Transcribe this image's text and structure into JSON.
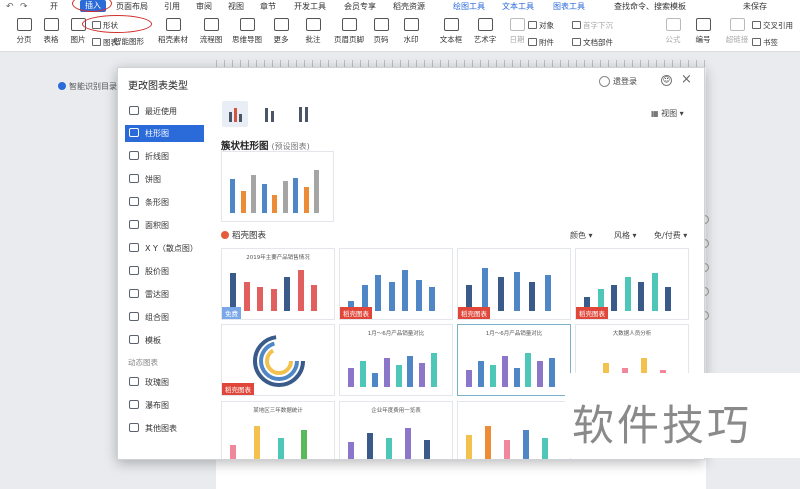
{
  "menu": {
    "items": [
      "开",
      "插入",
      "页面布局",
      "引用",
      "审阅",
      "视图",
      "章节",
      "开发工具",
      "会员专享",
      "稻壳资源",
      "绘图工具",
      "文本工具",
      "图表工具"
    ],
    "active": "插入",
    "right": [
      "查找命令、搜索模板",
      "未保存"
    ]
  },
  "ribbon": {
    "buttons": [
      "分页",
      "表格",
      "图片",
      "图表",
      "智能图形",
      "稻壳素材",
      "流程图",
      "思维导图",
      "更多",
      "批注",
      "页眉页脚",
      "页码",
      "水印",
      "文本框",
      "艺术字",
      "日期",
      "附件",
      "文档部件",
      "公式",
      "编号",
      "超链接",
      "书签"
    ],
    "small": [
      "形状",
      "对象",
      "首字下沉",
      "交叉引用"
    ]
  },
  "document": {
    "outline_tab": "智能识别目录"
  },
  "dialog": {
    "title": "更改图表类型",
    "user": "遗登录",
    "feedback": "☺",
    "close": "×",
    "view_label": "视图",
    "sidebar": [
      "最近使用",
      "柱形图",
      "折线图",
      "饼图",
      "条形图",
      "面积图",
      "X Y（散点图）",
      "股价图",
      "雷达图",
      "组合图",
      "模板"
    ],
    "sidebar_active": "柱形图",
    "online_section": "动态图表",
    "online_items": [
      "玫瑰图",
      "瀑布图",
      "其他图表"
    ],
    "subtype_title": "簇状柱形图",
    "subtype_tag": "(预设图表)",
    "templates_title": "稻壳图表",
    "filters": [
      "颜色",
      "风格",
      "免/付费"
    ],
    "badge_label": "稻壳图表",
    "badge_free": "免费",
    "card_titles": [
      "2019年主要产品销售情况",
      "1月～6月产品销量对比",
      "1月～6月产品销量对比",
      "大数据人员分析",
      "某地区三年数据统计",
      "企业年度费用一览表"
    ]
  },
  "chart_colors": {
    "blue": "#4f86c6",
    "orange": "#ed8c37",
    "gray": "#a5a5a5",
    "navy": "#3a5a8a",
    "red": "#e15f5f",
    "teal": "#4fc7b8",
    "purple": "#8b76c9",
    "yellow": "#f2c14e",
    "pink": "#f0879a",
    "green": "#5cb85c"
  },
  "watermark": "软件技巧"
}
